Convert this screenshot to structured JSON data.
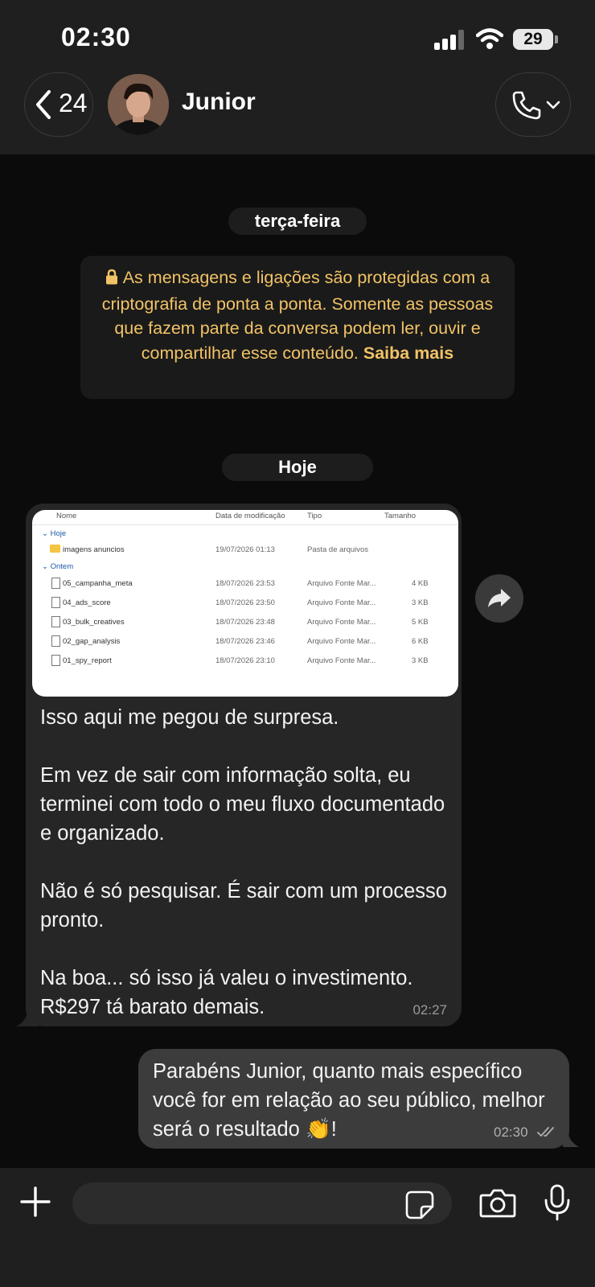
{
  "status_bar": {
    "time": "02:30",
    "battery": "29"
  },
  "header": {
    "back_count": "24",
    "contact_name": "Junior"
  },
  "chat": {
    "day_label_1": "terça-feira",
    "encryption_notice": "As mensagens e ligações são protegidas com a criptografia de ponta a ponta. Somente as pessoas que fazem parte da conversa podem ler, ouvir e compartilhar esse conteúdo.",
    "encryption_link": "Saiba mais",
    "day_label_2": "Hoje",
    "incoming": {
      "attachment": {
        "columns": [
          "Nome",
          "Data de modificação",
          "Tipo",
          "Tamanho"
        ],
        "groups": [
          {
            "label": "Hoje",
            "rows": [
              {
                "name": "imagens anuncios",
                "date": "19/07/2026 01:13",
                "type": "Pasta de arquivos",
                "size": "",
                "icon": "folder"
              }
            ]
          },
          {
            "label": "Ontem",
            "rows": [
              {
                "name": "05_campanha_meta",
                "date": "18/07/2026 23:53",
                "type": "Arquivo Fonte Mar...",
                "size": "4 KB",
                "icon": "file"
              },
              {
                "name": "04_ads_score",
                "date": "18/07/2026 23:50",
                "type": "Arquivo Fonte Mar...",
                "size": "3 KB",
                "icon": "file"
              },
              {
                "name": "03_bulk_creatives",
                "date": "18/07/2026 23:48",
                "type": "Arquivo Fonte Mar...",
                "size": "5 KB",
                "icon": "file"
              },
              {
                "name": "02_gap_analysis",
                "date": "18/07/2026 23:46",
                "type": "Arquivo Fonte Mar...",
                "size": "6 KB",
                "icon": "file"
              },
              {
                "name": "01_spy_report",
                "date": "18/07/2026 23:10",
                "type": "Arquivo Fonte Mar...",
                "size": "3 KB",
                "icon": "file"
              }
            ]
          }
        ]
      },
      "text": "Isso aqui me pegou de surpresa.\n\nEm vez de sair com informação solta, eu terminei com todo o meu fluxo documentado e organizado.\n\nNão é só pesquisar. É sair com um processo pronto.\n\nNa boa... só isso já valeu o investimento. R$297 tá barato demais.",
      "time": "02:27"
    },
    "outgoing": {
      "text": "Parabéns Junior, quanto mais específico você for em relação ao seu público, melhor será o resultado 👏!",
      "time": "02:30"
    }
  }
}
